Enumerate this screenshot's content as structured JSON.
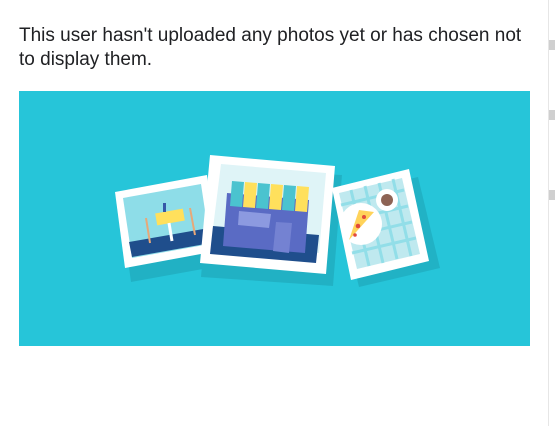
{
  "empty_state": {
    "message": "This user hasn't uploaded any photos yet or has chosen not to display them."
  },
  "illustration": {
    "name": "photos-empty-illustration",
    "background_color": "#26c5d9",
    "photos": [
      "restaurant-photo-icon",
      "storefront-photo-icon",
      "pizza-photo-icon"
    ]
  }
}
